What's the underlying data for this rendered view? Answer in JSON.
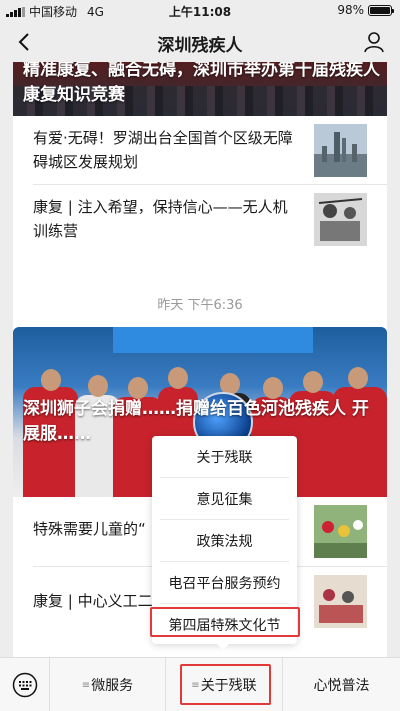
{
  "status_bar": {
    "carrier": "中国移动",
    "network": "4G",
    "time": "上午11:08",
    "battery": "98%",
    "battery_level": 0.98
  },
  "nav": {
    "title": "深圳残疾人",
    "back_icon": "chevron-left-icon",
    "profile_icon": "person-icon"
  },
  "card1": {
    "hero_caption": "精准康复、融合无碍，深圳市举办第十届残疾人康复知识竞赛",
    "items": [
      {
        "text": "有爱·无碍！罗湖出台全国首个区级无障碍城区发展规划"
      },
      {
        "text": "康复 | 注入希望，保持信心——无人机训练营"
      }
    ]
  },
  "timestamp": "昨天 下午6:36",
  "card2": {
    "hero_caption": "深圳狮子会捐赠……捐赠给百色河池残疾人 开展服……",
    "items": [
      {
        "text": "特殊需要儿童的“"
      },
      {
        "text": "康复 | 中心义工二"
      }
    ]
  },
  "popup": {
    "items": [
      "关于残联",
      "意见征集",
      "政策法规",
      "电召平台服务预约",
      "第四届特殊文化节"
    ]
  },
  "bottom_menu": {
    "keyboard_icon": "keyboard-icon",
    "tabs": [
      "微服务",
      "关于残联",
      "心悦普法"
    ]
  },
  "colors": {
    "highlight": "#e23a3a",
    "background": "#ededed"
  }
}
